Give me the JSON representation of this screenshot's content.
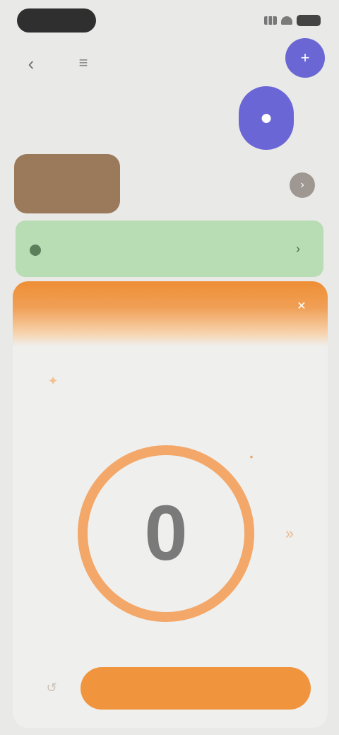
{
  "status_bar": {
    "time": "",
    "icons": [
      "signal-icon",
      "wifi-icon",
      "battery-icon"
    ]
  },
  "header": {
    "title": "",
    "back_icon": "chevron-left-icon",
    "menu_icon": "menu-icon"
  },
  "fabs": {
    "small_icon": "plus-icon",
    "large_icon": "chat-icon",
    "color": "#6a67d4"
  },
  "brown_row": {
    "block_label": "",
    "text": "",
    "chip_icon": "chevron-right-icon",
    "color": "#9b7a5c"
  },
  "green_banner": {
    "text": "",
    "color": "#b8dcb3"
  },
  "sheet": {
    "accent_color": "#f0953e",
    "header_left": "",
    "header_mid": "",
    "close_icon": "close-icon",
    "title": "",
    "subtitle": "",
    "counter_value": "0",
    "primary_button_label": ""
  }
}
